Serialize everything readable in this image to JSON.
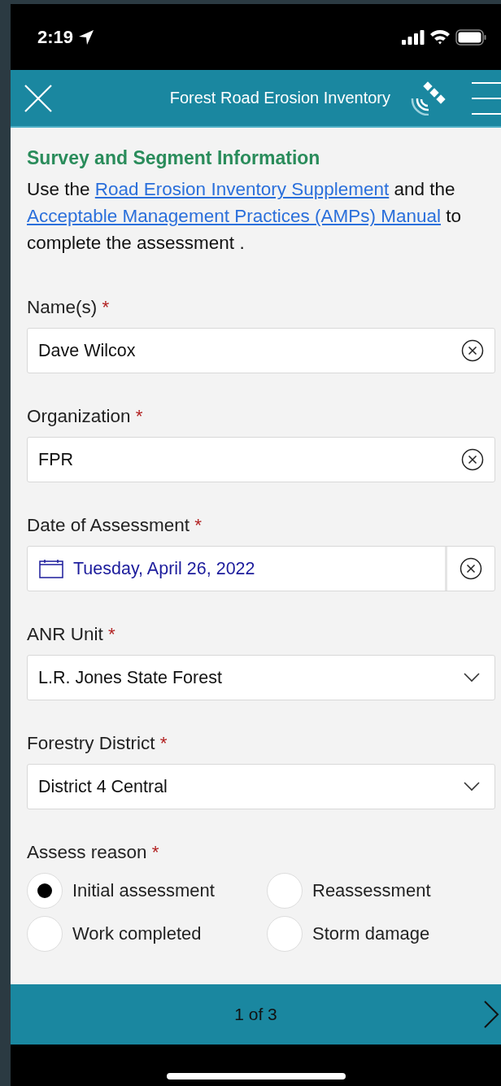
{
  "status_bar": {
    "time": "2:19"
  },
  "header": {
    "title": "Forest Road Erosion Inventory"
  },
  "section": {
    "title": "Survey and Segment Information",
    "intro": [
      {
        "kind": "text",
        "text": "Use the "
      },
      {
        "kind": "link",
        "text": "Road Erosion Inventory Supplement"
      },
      {
        "kind": "text",
        "text": " and the "
      },
      {
        "kind": "link",
        "text": "Acceptable Management Practices (AMPs) Manual"
      },
      {
        "kind": "text",
        "text": " to complete the assessment ."
      }
    ]
  },
  "fields": [
    {
      "kind": "text",
      "label": "Name(s)",
      "required_mark": "*",
      "value": "Dave Wilcox"
    },
    {
      "kind": "text",
      "label": "Organization",
      "required_mark": "*",
      "value": "FPR"
    },
    {
      "kind": "date",
      "label": "Date of Assessment",
      "required_mark": "*",
      "value": "Tuesday, April 26, 2022"
    },
    {
      "kind": "select",
      "label": "ANR Unit",
      "required_mark": "*",
      "value": "L.R. Jones State Forest"
    },
    {
      "kind": "select",
      "label": "Forestry District",
      "required_mark": "*",
      "value": "District 4 Central"
    },
    {
      "kind": "radio",
      "label": "Assess reason",
      "required_mark": "*",
      "options": [
        {
          "label": "Initial assessment",
          "selected": true
        },
        {
          "label": "Reassessment",
          "selected": false
        },
        {
          "label": "Work completed",
          "selected": false
        },
        {
          "label": "Storm damage",
          "selected": false
        }
      ]
    }
  ],
  "footer": {
    "page": "1 of 3"
  }
}
